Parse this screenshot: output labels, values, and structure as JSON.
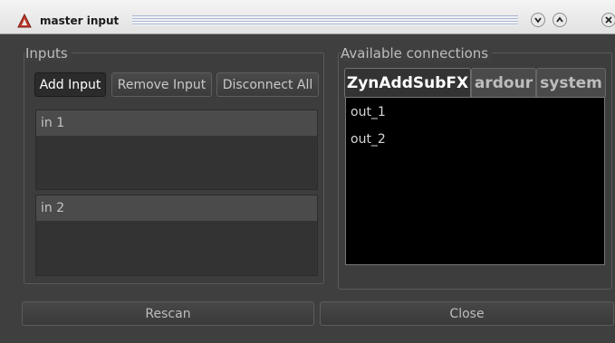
{
  "window": {
    "title": "master input"
  },
  "inputs_group": {
    "title": "Inputs",
    "buttons": {
      "add": "Add Input",
      "remove": "Remove Input",
      "disconnect": "Disconnect All"
    },
    "ports": [
      {
        "label": "in 1"
      },
      {
        "label": "in 2"
      }
    ]
  },
  "connections_group": {
    "title": "Available connections",
    "tabs": [
      {
        "label": "ZynAddSubFX",
        "active": true
      },
      {
        "label": "ardour",
        "active": false
      },
      {
        "label": "system",
        "active": false
      }
    ],
    "items": [
      "out_1",
      "out_2"
    ]
  },
  "footer": {
    "rescan": "Rescan",
    "close": "Close"
  },
  "icons": {
    "app": "ardour-logo-icon",
    "minimize": "chevron-down-icon",
    "maximize": "chevron-up-icon",
    "close": "close-icon"
  },
  "colors": {
    "window_bg": "#3f3f3f",
    "list_bg": "#000000",
    "app_icon": "#c0392b"
  }
}
